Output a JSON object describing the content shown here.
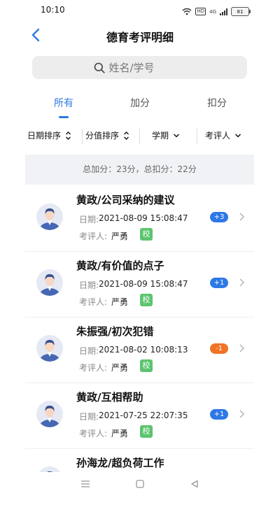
{
  "status_bar": {
    "time": "10:10",
    "hd": "HD",
    "network": "4G",
    "battery": "81"
  },
  "header": {
    "title": "德育考评明细"
  },
  "search": {
    "placeholder": "姓名/学号"
  },
  "tabs": [
    {
      "label": "所有",
      "active": true
    },
    {
      "label": "加分",
      "active": false
    },
    {
      "label": "扣分",
      "active": false
    }
  ],
  "filters": [
    {
      "label": "日期排序",
      "icon": "sort-updown-icon"
    },
    {
      "label": "分值排序",
      "icon": "sort-updown-icon"
    },
    {
      "label": "学期",
      "icon": "chevron-down-icon"
    },
    {
      "label": "考评人",
      "icon": "chevron-down-icon"
    }
  ],
  "summary": {
    "text": "总加分：23分，总扣分：22分"
  },
  "labels": {
    "date": "日期:",
    "evaluator": "考评人:"
  },
  "records": [
    {
      "title": "黄政/公司采纳的建议",
      "date": "2021-08-09 15:08:47",
      "evaluator": "严勇",
      "tag": "校",
      "score": "+3",
      "type": "plus"
    },
    {
      "title": "黄政/有价值的点子",
      "date": "2021-08-09 15:08:47",
      "evaluator": "严勇",
      "tag": "校",
      "score": "+1",
      "type": "plus"
    },
    {
      "title": "朱振强/初次犯错",
      "date": "2021-08-02 10:08:13",
      "evaluator": "严勇",
      "tag": "校",
      "score": "-1",
      "type": "minus"
    },
    {
      "title": "黄政/互相帮助",
      "date": "2021-07-25 22:07:35",
      "evaluator": "严勇",
      "tag": "校",
      "score": "+1",
      "type": "plus"
    },
    {
      "title": "孙海龙/超负荷工作",
      "date": "",
      "evaluator": "",
      "tag": "",
      "score": "",
      "type": "plus"
    }
  ],
  "colors": {
    "accent": "#2e78e6",
    "plus_badge": "#2e78e6",
    "minus_badge": "#f07326",
    "tag": "#5cc46f"
  }
}
